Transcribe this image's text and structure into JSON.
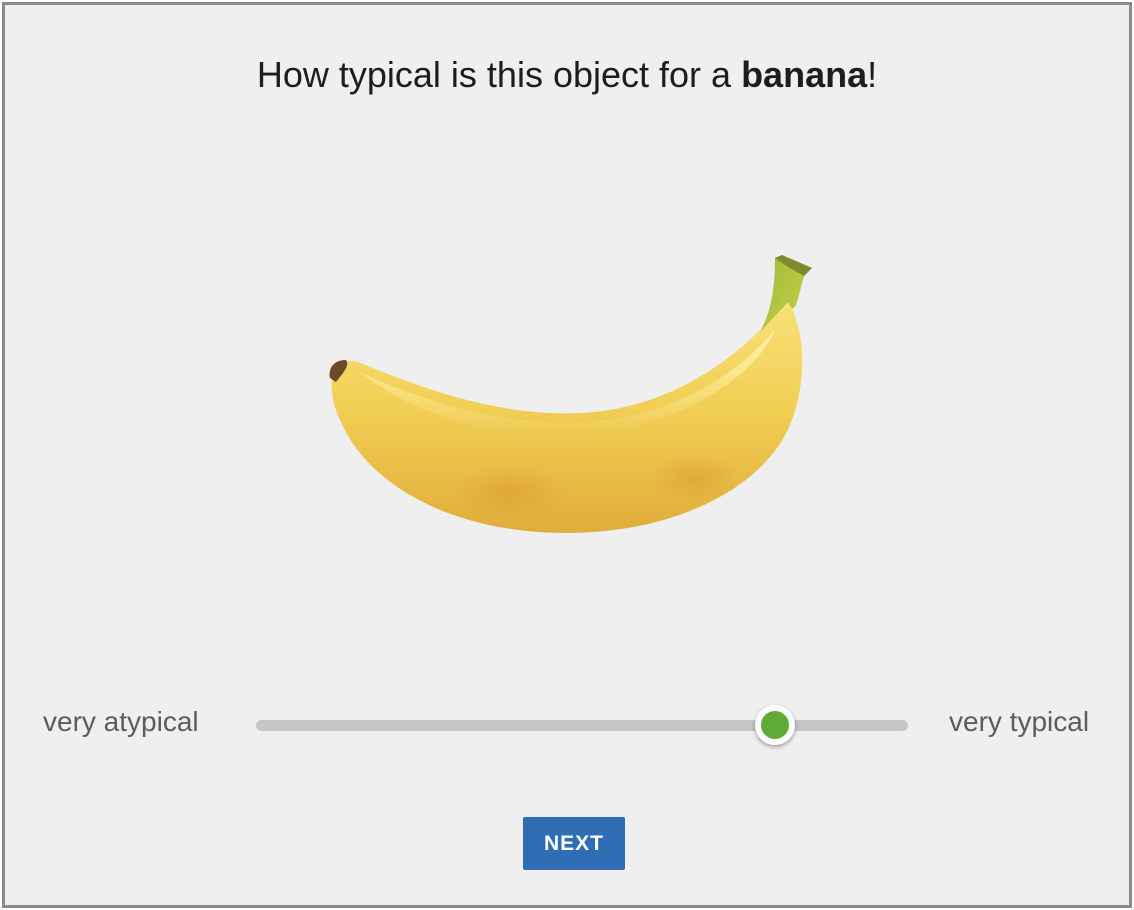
{
  "question": {
    "prefix": "How typical is this object for a ",
    "target": "banana",
    "suffix": "!"
  },
  "stimulus": {
    "object": "banana-image"
  },
  "scale": {
    "left_label": "very atypical",
    "right_label": "very typical",
    "value_fraction": 0.796,
    "track_color": "#c6c6c6",
    "thumb_color": "#5faa38"
  },
  "next_button": {
    "label": "NEXT",
    "color": "#2f6db4"
  }
}
